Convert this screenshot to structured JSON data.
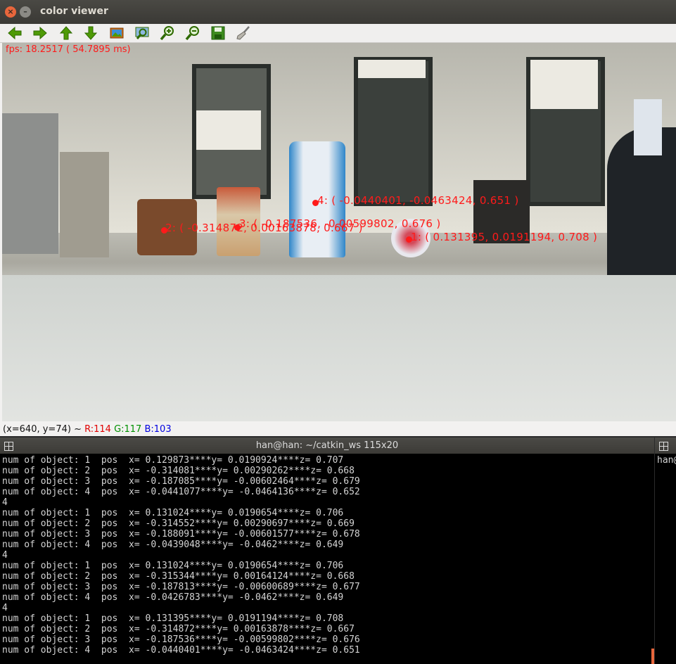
{
  "viewer": {
    "title": "color viewer",
    "toolbar_icons": [
      "arrow-left-icon",
      "arrow-right-icon",
      "arrow-up-icon",
      "arrow-down-icon",
      "image-icon",
      "zoom-fit-icon",
      "zoom-in-icon",
      "zoom-out-icon",
      "save-icon",
      "clear-brush-icon"
    ],
    "fps_text": "fps: 18.2517 ( 54.7895 ms)",
    "annotations": [
      {
        "label": "1: ( 0.131395, 0.0191194, 0.708 )"
      },
      {
        "label": "2: ( -0.314872, 0.00163878, 0.667 )"
      },
      {
        "label": "3: ( -0.187536, -0.00599802, 0.676 )"
      },
      {
        "label": "4: ( -0.0440401, -0.0463424, 0.651 )"
      }
    ],
    "status": {
      "coords": "(x=640, y=74) ~ ",
      "r": "R:114",
      "g": "G:117",
      "b": "B:103"
    }
  },
  "terminal": {
    "title": "han@han: ~/catkin_ws 115x20",
    "lines": [
      "num of object: 1  pos  x= 0.129873****y= 0.0190924****z= 0.707",
      "num of object: 2  pos  x= -0.314081****y= 0.00290262****z= 0.668",
      "num of object: 3  pos  x= -0.187085****y= -0.00602464****z= 0.679",
      "num of object: 4  pos  x= -0.0441077****y= -0.0464136****z= 0.652",
      "4",
      "num of object: 1  pos  x= 0.131024****y= 0.0190654****z= 0.706",
      "num of object: 2  pos  x= -0.314552****y= 0.00290697****z= 0.669",
      "num of object: 3  pos  x= -0.188091****y= -0.00601577****z= 0.678",
      "num of object: 4  pos  x= -0.0439048****y= -0.0462****z= 0.649",
      "4",
      "num of object: 1  pos  x= 0.131024****y= 0.0190654****z= 0.706",
      "num of object: 2  pos  x= -0.315344****y= 0.00164124****z= 0.668",
      "num of object: 3  pos  x= -0.187813****y= -0.00600689****z= 0.677",
      "num of object: 4  pos  x= -0.0426783****y= -0.0462****z= 0.649",
      "4",
      "num of object: 1  pos  x= 0.131395****y= 0.0191194****z= 0.708",
      "num of object: 2  pos  x= -0.314872****y= 0.00163878****z= 0.667",
      "num of object: 3  pos  x= -0.187536****y= -0.00599802****z= 0.676",
      "num of object: 4  pos  x= -0.0440401****y= -0.0463424****z= 0.651"
    ]
  },
  "terminal2": {
    "text": "han@"
  }
}
